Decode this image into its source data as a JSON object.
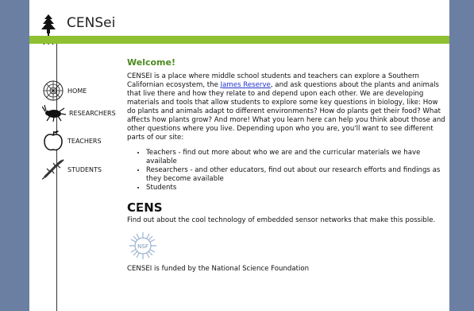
{
  "header": {
    "site_title": "CENSei"
  },
  "nav": {
    "items": [
      {
        "label": "HOME",
        "icon": "spider-web-icon"
      },
      {
        "label": "RESEARCHERS",
        "icon": "beetle-icon"
      },
      {
        "label": "TEACHERS",
        "icon": "apple-icon"
      },
      {
        "label": "STUDENTS",
        "icon": "lizard-icon"
      }
    ]
  },
  "main": {
    "welcome": "Welcome!",
    "intro_before_link": "CENSEI is a place where middle school students and teachers can explore a Southern Californian ecosystem, the ",
    "intro_link": "James Reserve",
    "intro_after_link": ", and ask questions about the plants and animals that live there and how they relate to and depend upon each other. We are developing materials and tools that allow students to explore some key questions in biology, like: How do plants and animals adapt to different environments? How do plants get their food? What affects how plants grow? And more! What you learn here can help you think about those and other questions where you live. Depending upon who you are, you'll want to see different parts of our site:",
    "audience": [
      "Teachers - find out more about who we are and the curricular materials we have available",
      "Researchers - and other educators, find out about our research efforts and findings as they become available",
      "Students"
    ],
    "cens_logo_text": "CENS",
    "cens_description": "Find out about the cool technology of embedded sensor networks that make this possible.",
    "nsf_logo_text": "NSF",
    "funding": "CENSEI is funded by the National Science Foundation"
  },
  "colors": {
    "accent_green": "#8fc033",
    "welcome_green": "#4d8a1f",
    "background": "#6b7fa3",
    "link": "#2233cc"
  }
}
